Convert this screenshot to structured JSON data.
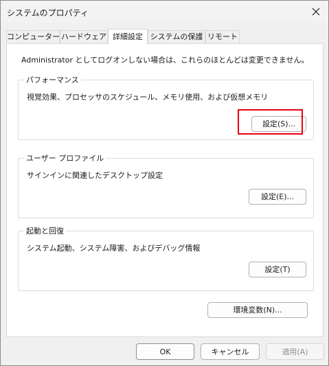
{
  "window": {
    "title": "システムのプロパティ"
  },
  "tabs": [
    {
      "label": "コンピューター名"
    },
    {
      "label": "ハードウェア"
    },
    {
      "label": "詳細設定"
    },
    {
      "label": "システムの保護"
    },
    {
      "label": "リモート"
    }
  ],
  "notice": "Administrator としてログオンしない場合は、これらのほとんどは変更できません。",
  "performance": {
    "legend": "パフォーマンス",
    "description": "視覚効果、プロセッサのスケジュール、メモリ使用、および仮想メモリ",
    "button": "設定(S)..."
  },
  "user_profile": {
    "legend": "ユーザー プロファイル",
    "description": "サインインに関連したデスクトップ設定",
    "button": "設定(E)..."
  },
  "startup": {
    "legend": "起動と回復",
    "description": "システム起動、システム障害、およびデバッグ情報",
    "button": "設定(T)"
  },
  "env_button": "環境変数(N)...",
  "footer": {
    "ok": "OK",
    "cancel": "キャンセル",
    "apply": "適用(A)"
  },
  "colors": {
    "highlight": "#e60012"
  }
}
